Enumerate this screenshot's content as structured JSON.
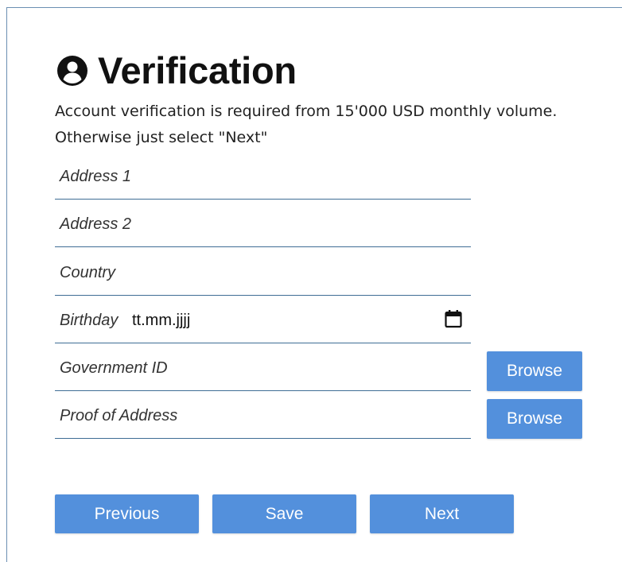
{
  "page": {
    "title": "Verification",
    "icon": "user-circle-icon",
    "description_line1": "Account verification is required from 15'000 USD monthly volume.",
    "description_line2": "Otherwise just select \"Next\""
  },
  "form": {
    "address1": {
      "label": "Address 1",
      "value": ""
    },
    "address2": {
      "label": "Address 2",
      "value": ""
    },
    "country": {
      "label": "Country",
      "value": ""
    },
    "birthday": {
      "label": "Birthday",
      "value": "tt.mm.jjjj",
      "icon": "calendar-icon"
    },
    "government_id": {
      "label": "Government ID",
      "browse_label": "Browse"
    },
    "proof_of_address": {
      "label": "Proof of Address",
      "browse_label": "Browse"
    }
  },
  "actions": {
    "previous_label": "Previous",
    "save_label": "Save",
    "next_label": "Next"
  },
  "colors": {
    "button_bg": "#5390dc",
    "field_underline": "#3f6d95",
    "text": "#111111"
  }
}
